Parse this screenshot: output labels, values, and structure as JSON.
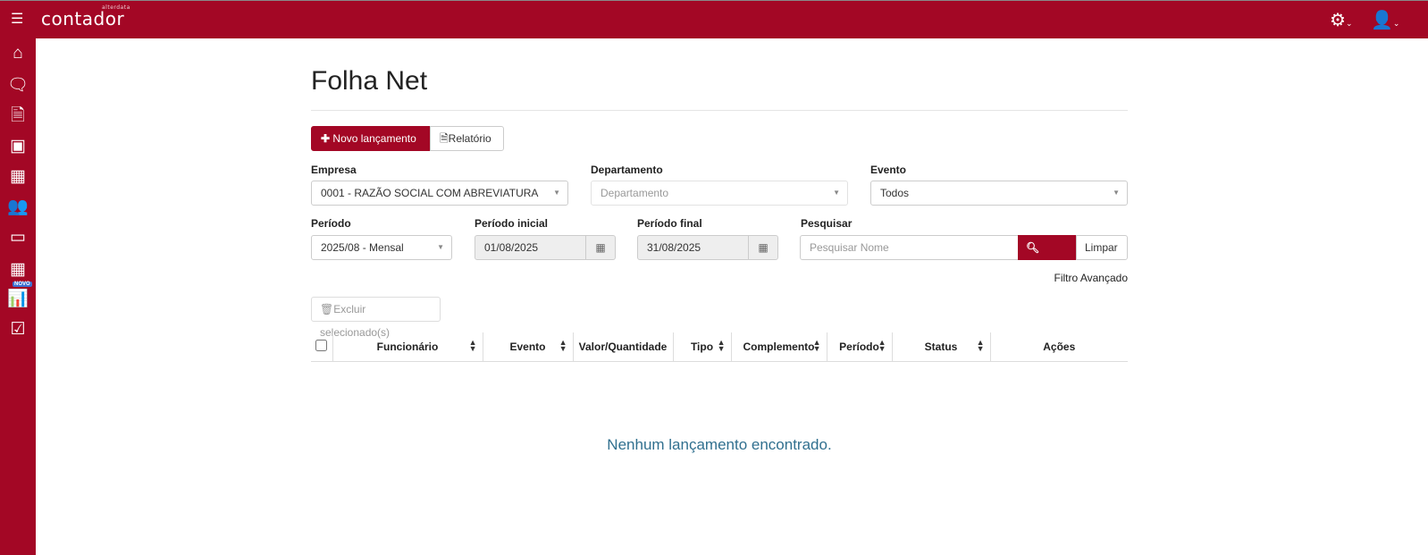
{
  "header": {
    "logo": "contador",
    "logo_sub": "alterdata"
  },
  "page": {
    "title": "Folha Net"
  },
  "toolbar": {
    "new_label": "Novo lançamento",
    "report_label": "Relatório",
    "delete_label": "Excluir selecionado(s)"
  },
  "filters": {
    "empresa": {
      "label": "Empresa",
      "value": "0001 - RAZÃO SOCIAL COM ABREVIATURA"
    },
    "departamento": {
      "label": "Departamento",
      "placeholder": "Departamento"
    },
    "evento": {
      "label": "Evento",
      "value": "Todos"
    },
    "periodo": {
      "label": "Período",
      "value": "2025/08 - Mensal"
    },
    "periodo_inicial": {
      "label": "Período inicial",
      "value": "01/08/2025"
    },
    "periodo_final": {
      "label": "Período final",
      "value": "31/08/2025"
    },
    "pesquisar": {
      "label": "Pesquisar",
      "placeholder": "Pesquisar Nome"
    },
    "filtrar_label": "Filtrar",
    "limpar_label": "Limpar",
    "advanced_label": "Filtro Avançado"
  },
  "sidebar": {
    "badge": "NOVO"
  },
  "table": {
    "columns": [
      "Funcionário",
      "Evento",
      "Valor/Quantidade",
      "Tipo",
      "Complemento",
      "Período",
      "Status",
      "Ações"
    ],
    "empty": "Nenhum lançamento encontrado."
  },
  "colors": {
    "brand": "#a30725"
  }
}
